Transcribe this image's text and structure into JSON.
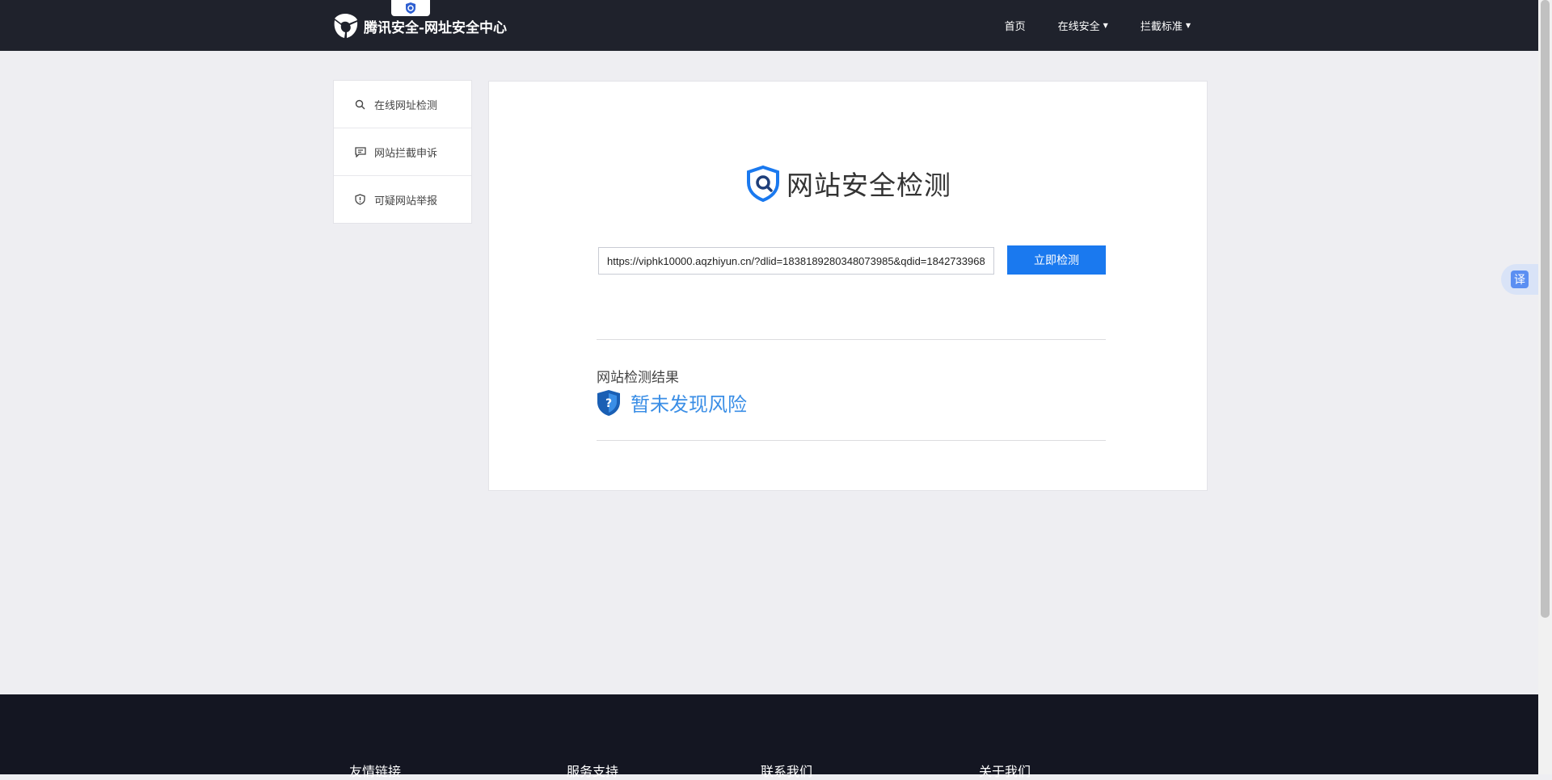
{
  "header": {
    "logo_text": "腾讯安全-网址安全中心",
    "nav": {
      "home": "首页",
      "online_security": "在线安全",
      "block_standard": "拦截标准"
    }
  },
  "sidebar": {
    "items": [
      {
        "label": "在线网址检测"
      },
      {
        "label": "网站拦截申诉"
      },
      {
        "label": "可疑网站举报"
      }
    ]
  },
  "main": {
    "title": "网站安全检测",
    "url_value": "https://viphk10000.aqzhiyun.cn/?dlid=1838189280348073985&qdid=1842733968",
    "scan_button": "立即检测",
    "result_label": "网站检测结果",
    "result_text": "暂未发现风险"
  },
  "translate_float": "译",
  "footer": {
    "columns": [
      "友情链接",
      "服务支持",
      "联系我们",
      "关于我们"
    ]
  },
  "colors": {
    "header_bg": "#1f222c",
    "accent": "#1a79ef",
    "result_blue": "#3a8ee6",
    "footer_bg": "#141622",
    "page_bg": "#eeeef2"
  }
}
